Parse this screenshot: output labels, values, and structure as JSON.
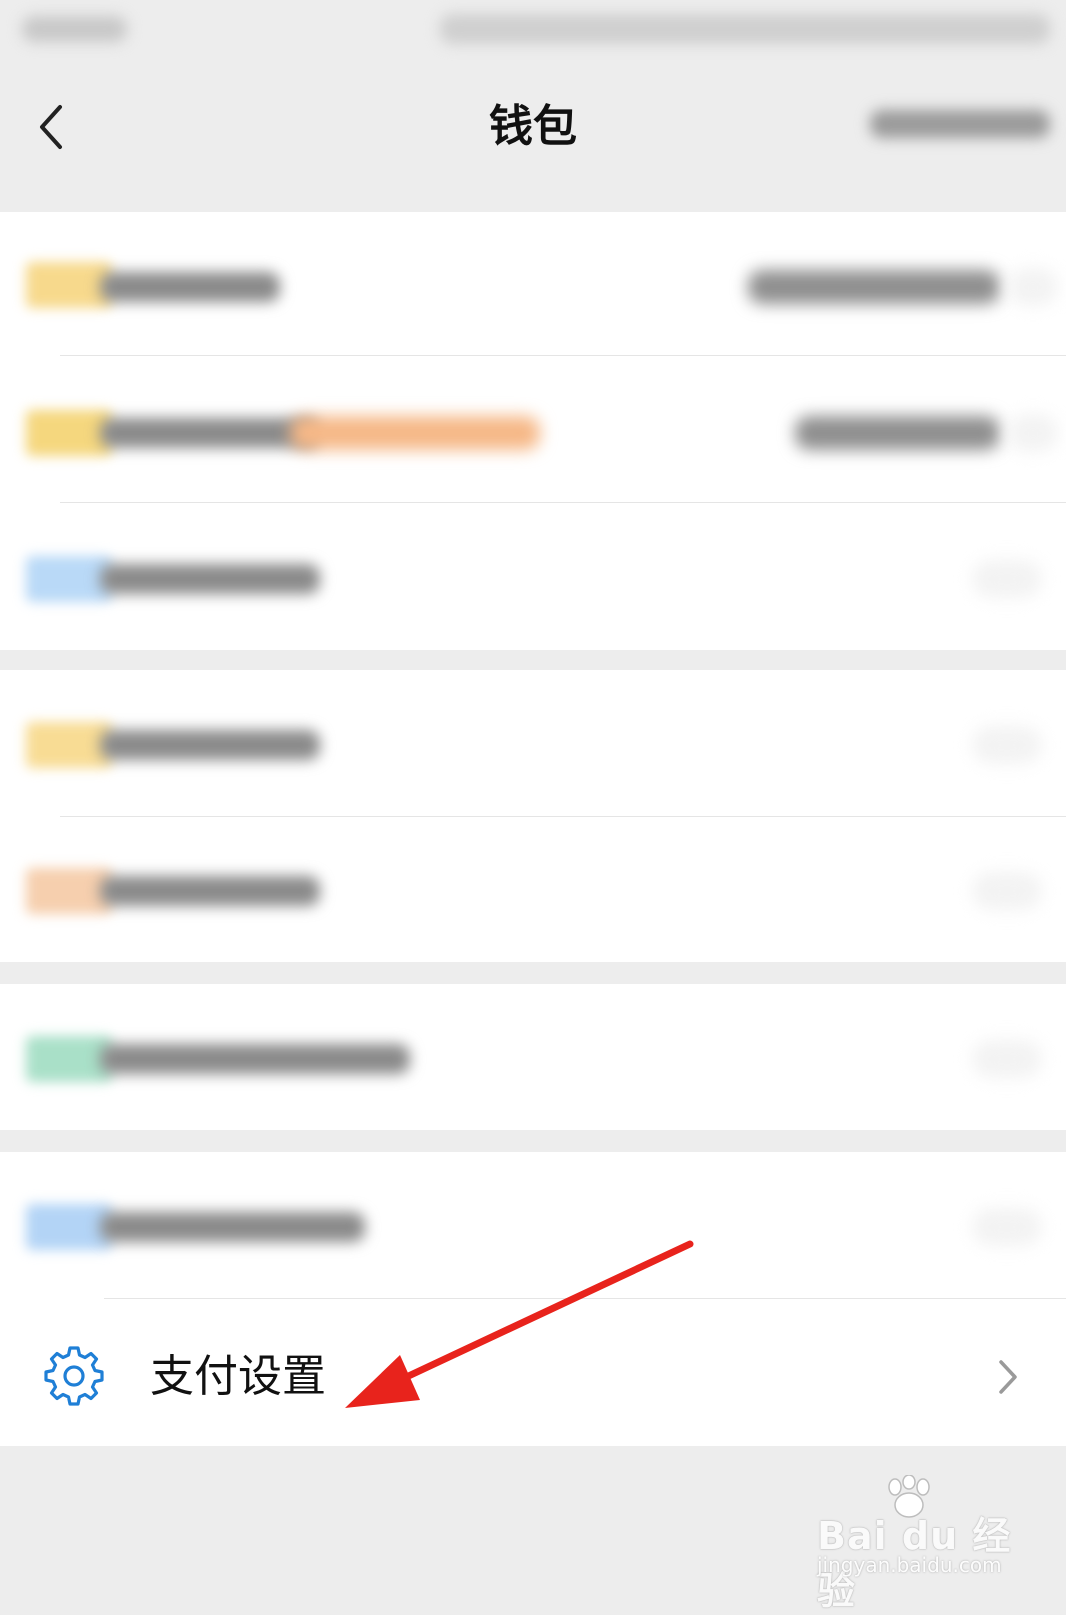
{
  "header": {
    "title": "钱包",
    "back_icon": "chevron-left-icon"
  },
  "settings_row": {
    "label": "支付设置",
    "icon": "gear-icon",
    "chevron": "chevron-right-icon"
  },
  "colors": {
    "background": "#ededed",
    "card": "#ffffff",
    "accent_blue": "#1f7fd6",
    "annotation_red": "#e8231c",
    "divider": "#e5e5e5"
  },
  "watermark": {
    "line1": "Bai du 经验",
    "line2": "jingyan.baidu.com"
  }
}
